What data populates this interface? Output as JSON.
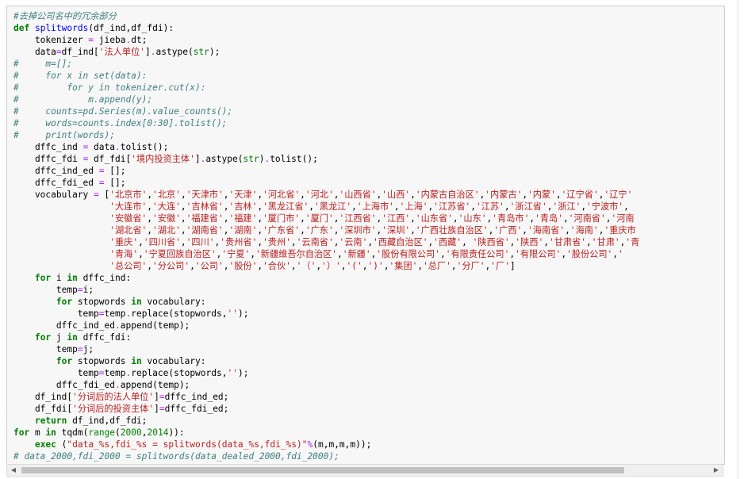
{
  "code_lines": [
    [
      {
        "c": "cm",
        "t": "#去掉公司名中的冗余部分"
      }
    ],
    [
      {
        "c": "kw",
        "t": "def "
      },
      {
        "c": "fn",
        "t": "splitwords"
      },
      {
        "c": "",
        "t": "(df_ind,df_fdi):"
      }
    ],
    [
      {
        "c": "",
        "t": "    tokenizer "
      },
      {
        "c": "op",
        "t": "="
      },
      {
        "c": "",
        "t": " jieba"
      },
      {
        "c": "op",
        "t": "."
      },
      {
        "c": "",
        "t": "dt;"
      }
    ],
    [
      {
        "c": "",
        "t": "    data"
      },
      {
        "c": "op",
        "t": "="
      },
      {
        "c": "",
        "t": "df_ind["
      },
      {
        "c": "st",
        "t": "'法人单位'"
      },
      {
        "c": "",
        "t": "]"
      },
      {
        "c": "op",
        "t": "."
      },
      {
        "c": "",
        "t": "astype("
      },
      {
        "c": "bi",
        "t": "str"
      },
      {
        "c": "",
        "t": ");"
      }
    ],
    [
      {
        "c": "cm",
        "t": "#     m=[];"
      }
    ],
    [
      {
        "c": "cm",
        "t": "#     for x in set(data):"
      }
    ],
    [
      {
        "c": "cm",
        "t": "#         for y in tokenizer.cut(x):"
      }
    ],
    [
      {
        "c": "cm",
        "t": "#             m.append(y);"
      }
    ],
    [
      {
        "c": "cm",
        "t": "#     counts=pd.Series(m).value_counts();"
      }
    ],
    [
      {
        "c": "cm",
        "t": "#     words=counts.index[0:30].tolist();"
      }
    ],
    [
      {
        "c": "cm",
        "t": "#     print(words);"
      }
    ],
    [
      {
        "c": "",
        "t": "    dffc_ind "
      },
      {
        "c": "op",
        "t": "="
      },
      {
        "c": "",
        "t": " data"
      },
      {
        "c": "op",
        "t": "."
      },
      {
        "c": "",
        "t": "tolist();"
      }
    ],
    [
      {
        "c": "",
        "t": "    dffc_fdi "
      },
      {
        "c": "op",
        "t": "="
      },
      {
        "c": "",
        "t": " df_fdi["
      },
      {
        "c": "st",
        "t": "'境内投资主体'"
      },
      {
        "c": "",
        "t": "]"
      },
      {
        "c": "op",
        "t": "."
      },
      {
        "c": "",
        "t": "astype("
      },
      {
        "c": "bi",
        "t": "str"
      },
      {
        "c": "",
        "t": ")"
      },
      {
        "c": "op",
        "t": "."
      },
      {
        "c": "",
        "t": "tolist();"
      }
    ],
    [
      {
        "c": "",
        "t": "    dffc_ind_ed "
      },
      {
        "c": "op",
        "t": "="
      },
      {
        "c": "",
        "t": " [];"
      }
    ],
    [
      {
        "c": "",
        "t": "    dffc_fdi_ed "
      },
      {
        "c": "op",
        "t": "="
      },
      {
        "c": "",
        "t": " [];"
      }
    ],
    [
      {
        "c": "",
        "t": "    vocabulary "
      },
      {
        "c": "op",
        "t": "="
      },
      {
        "c": "",
        "t": " ["
      },
      {
        "c": "st",
        "t": "'北京市'"
      },
      {
        "c": "",
        "t": ","
      },
      {
        "c": "st",
        "t": "'北京'"
      },
      {
        "c": "",
        "t": ","
      },
      {
        "c": "st",
        "t": "'天津市'"
      },
      {
        "c": "",
        "t": ","
      },
      {
        "c": "st",
        "t": "'天津'"
      },
      {
        "c": "",
        "t": ","
      },
      {
        "c": "st",
        "t": "'河北省'"
      },
      {
        "c": "",
        "t": ","
      },
      {
        "c": "st",
        "t": "'河北'"
      },
      {
        "c": "",
        "t": ","
      },
      {
        "c": "st",
        "t": "'山西省'"
      },
      {
        "c": "",
        "t": ","
      },
      {
        "c": "st",
        "t": "'山西'"
      },
      {
        "c": "",
        "t": ","
      },
      {
        "c": "st",
        "t": "'内蒙古自治区'"
      },
      {
        "c": "",
        "t": ","
      },
      {
        "c": "st",
        "t": "'内蒙古'"
      },
      {
        "c": "",
        "t": ","
      },
      {
        "c": "st",
        "t": "'内蒙'"
      },
      {
        "c": "",
        "t": ","
      },
      {
        "c": "st",
        "t": "'辽宁省'"
      },
      {
        "c": "",
        "t": ","
      },
      {
        "c": "st",
        "t": "'辽宁'"
      }
    ],
    [
      {
        "c": "",
        "t": "                  "
      },
      {
        "c": "st",
        "t": "'大连市'"
      },
      {
        "c": "",
        "t": ","
      },
      {
        "c": "st",
        "t": "'大连'"
      },
      {
        "c": "",
        "t": ","
      },
      {
        "c": "st",
        "t": "'吉林省'"
      },
      {
        "c": "",
        "t": ","
      },
      {
        "c": "st",
        "t": "'吉林'"
      },
      {
        "c": "",
        "t": ","
      },
      {
        "c": "st",
        "t": "'黑龙江省'"
      },
      {
        "c": "",
        "t": ","
      },
      {
        "c": "st",
        "t": "'黑龙江'"
      },
      {
        "c": "",
        "t": ","
      },
      {
        "c": "st",
        "t": "'上海市'"
      },
      {
        "c": "",
        "t": ","
      },
      {
        "c": "st",
        "t": "'上海'"
      },
      {
        "c": "",
        "t": ","
      },
      {
        "c": "st",
        "t": "'江苏省'"
      },
      {
        "c": "",
        "t": ","
      },
      {
        "c": "st",
        "t": "'江苏'"
      },
      {
        "c": "",
        "t": ","
      },
      {
        "c": "st",
        "t": "'浙江省'"
      },
      {
        "c": "",
        "t": ","
      },
      {
        "c": "st",
        "t": "'浙江'"
      },
      {
        "c": "",
        "t": ","
      },
      {
        "c": "st",
        "t": "'宁波市'"
      },
      {
        "c": "",
        "t": ","
      }
    ],
    [
      {
        "c": "",
        "t": "                  "
      },
      {
        "c": "st",
        "t": "'安徽省'"
      },
      {
        "c": "",
        "t": ","
      },
      {
        "c": "st",
        "t": "'安徽'"
      },
      {
        "c": "",
        "t": ","
      },
      {
        "c": "st",
        "t": "'福建省'"
      },
      {
        "c": "",
        "t": ","
      },
      {
        "c": "st",
        "t": "'福建'"
      },
      {
        "c": "",
        "t": ","
      },
      {
        "c": "st",
        "t": "'厦门市'"
      },
      {
        "c": "",
        "t": ","
      },
      {
        "c": "st",
        "t": "'厦门'"
      },
      {
        "c": "",
        "t": ","
      },
      {
        "c": "st",
        "t": "'江西省'"
      },
      {
        "c": "",
        "t": ","
      },
      {
        "c": "st",
        "t": "'江西'"
      },
      {
        "c": "",
        "t": ","
      },
      {
        "c": "st",
        "t": "'山东省'"
      },
      {
        "c": "",
        "t": ","
      },
      {
        "c": "st",
        "t": "'山东'"
      },
      {
        "c": "",
        "t": ","
      },
      {
        "c": "st",
        "t": "'青岛市'"
      },
      {
        "c": "",
        "t": ","
      },
      {
        "c": "st",
        "t": "'青岛'"
      },
      {
        "c": "",
        "t": ","
      },
      {
        "c": "st",
        "t": "'河南省'"
      },
      {
        "c": "",
        "t": ","
      },
      {
        "c": "st",
        "t": "'河南"
      }
    ],
    [
      {
        "c": "",
        "t": "                  "
      },
      {
        "c": "st",
        "t": "'湖北省'"
      },
      {
        "c": "",
        "t": ","
      },
      {
        "c": "st",
        "t": "'湖北'"
      },
      {
        "c": "",
        "t": ","
      },
      {
        "c": "st",
        "t": "'湖南省'"
      },
      {
        "c": "",
        "t": ","
      },
      {
        "c": "st",
        "t": "'湖南'"
      },
      {
        "c": "",
        "t": ","
      },
      {
        "c": "st",
        "t": "'广东省'"
      },
      {
        "c": "",
        "t": ","
      },
      {
        "c": "st",
        "t": "'广东'"
      },
      {
        "c": "",
        "t": ","
      },
      {
        "c": "st",
        "t": "'深圳市'"
      },
      {
        "c": "",
        "t": ","
      },
      {
        "c": "st",
        "t": "'深圳'"
      },
      {
        "c": "",
        "t": ","
      },
      {
        "c": "st",
        "t": "'广西壮族自治区'"
      },
      {
        "c": "",
        "t": ","
      },
      {
        "c": "st",
        "t": "'广西'"
      },
      {
        "c": "",
        "t": ","
      },
      {
        "c": "st",
        "t": "'海南省'"
      },
      {
        "c": "",
        "t": ","
      },
      {
        "c": "st",
        "t": "'海南'"
      },
      {
        "c": "",
        "t": ","
      },
      {
        "c": "st",
        "t": "'重庆市"
      }
    ],
    [
      {
        "c": "",
        "t": "                  "
      },
      {
        "c": "st",
        "t": "'重庆'"
      },
      {
        "c": "",
        "t": ","
      },
      {
        "c": "st",
        "t": "'四川省'"
      },
      {
        "c": "",
        "t": ","
      },
      {
        "c": "st",
        "t": "'四川'"
      },
      {
        "c": "",
        "t": ","
      },
      {
        "c": "st",
        "t": "'贵州省'"
      },
      {
        "c": "",
        "t": ","
      },
      {
        "c": "st",
        "t": "'贵州'"
      },
      {
        "c": "",
        "t": ","
      },
      {
        "c": "st",
        "t": "'云南省'"
      },
      {
        "c": "",
        "t": ","
      },
      {
        "c": "st",
        "t": "'云南'"
      },
      {
        "c": "",
        "t": ","
      },
      {
        "c": "st",
        "t": "'西藏自治区'"
      },
      {
        "c": "",
        "t": ","
      },
      {
        "c": "st",
        "t": "'西藏'"
      },
      {
        "c": "",
        "t": ", "
      },
      {
        "c": "st",
        "t": "'陕西省'"
      },
      {
        "c": "",
        "t": ","
      },
      {
        "c": "st",
        "t": "'陕西'"
      },
      {
        "c": "",
        "t": ","
      },
      {
        "c": "st",
        "t": "'甘肃省'"
      },
      {
        "c": "",
        "t": ","
      },
      {
        "c": "st",
        "t": "'甘肃'"
      },
      {
        "c": "",
        "t": ","
      },
      {
        "c": "st",
        "t": "'青"
      }
    ],
    [
      {
        "c": "",
        "t": "                  "
      },
      {
        "c": "st",
        "t": "'青海'"
      },
      {
        "c": "",
        "t": ","
      },
      {
        "c": "st",
        "t": "'宁夏回族自治区'"
      },
      {
        "c": "",
        "t": ","
      },
      {
        "c": "st",
        "t": "'宁夏'"
      },
      {
        "c": "",
        "t": ","
      },
      {
        "c": "st",
        "t": "'新疆维吾尔自治区'"
      },
      {
        "c": "",
        "t": ","
      },
      {
        "c": "st",
        "t": "'新疆'"
      },
      {
        "c": "",
        "t": ","
      },
      {
        "c": "st",
        "t": "'股份有限公司'"
      },
      {
        "c": "",
        "t": ","
      },
      {
        "c": "st",
        "t": "'有限责任公司'"
      },
      {
        "c": "",
        "t": ","
      },
      {
        "c": "st",
        "t": "'有限公司'"
      },
      {
        "c": "",
        "t": ","
      },
      {
        "c": "st",
        "t": "'股份公司'"
      },
      {
        "c": "",
        "t": ","
      },
      {
        "c": "st",
        "t": "'"
      }
    ],
    [
      {
        "c": "",
        "t": "                  "
      },
      {
        "c": "st",
        "t": "'总公司'"
      },
      {
        "c": "",
        "t": ","
      },
      {
        "c": "st",
        "t": "'分公司'"
      },
      {
        "c": "",
        "t": ","
      },
      {
        "c": "st",
        "t": "'公司'"
      },
      {
        "c": "",
        "t": ","
      },
      {
        "c": "st",
        "t": "'股份'"
      },
      {
        "c": "",
        "t": ","
      },
      {
        "c": "st",
        "t": "'合伙'"
      },
      {
        "c": "",
        "t": ","
      },
      {
        "c": "st",
        "t": "'（'"
      },
      {
        "c": "",
        "t": ","
      },
      {
        "c": "st",
        "t": "'）'"
      },
      {
        "c": "",
        "t": ","
      },
      {
        "c": "st",
        "t": "'('"
      },
      {
        "c": "",
        "t": ","
      },
      {
        "c": "st",
        "t": "')'"
      },
      {
        "c": "",
        "t": ","
      },
      {
        "c": "st",
        "t": "'集团'"
      },
      {
        "c": "",
        "t": ","
      },
      {
        "c": "st",
        "t": "'总厂'"
      },
      {
        "c": "",
        "t": ","
      },
      {
        "c": "st",
        "t": "'分厂'"
      },
      {
        "c": "",
        "t": ","
      },
      {
        "c": "st",
        "t": "'厂'"
      },
      {
        "c": "",
        "t": "]"
      }
    ],
    [
      {
        "c": "",
        "t": "    "
      },
      {
        "c": "kw",
        "t": "for"
      },
      {
        "c": "",
        "t": " i "
      },
      {
        "c": "kw",
        "t": "in"
      },
      {
        "c": "",
        "t": " dffc_ind:"
      }
    ],
    [
      {
        "c": "",
        "t": "        temp"
      },
      {
        "c": "op",
        "t": "="
      },
      {
        "c": "",
        "t": "i;"
      }
    ],
    [
      {
        "c": "",
        "t": "        "
      },
      {
        "c": "kw",
        "t": "for"
      },
      {
        "c": "",
        "t": " stopwords "
      },
      {
        "c": "kw",
        "t": "in"
      },
      {
        "c": "",
        "t": " vocabulary:"
      }
    ],
    [
      {
        "c": "",
        "t": "            temp"
      },
      {
        "c": "op",
        "t": "="
      },
      {
        "c": "",
        "t": "temp"
      },
      {
        "c": "op",
        "t": "."
      },
      {
        "c": "",
        "t": "replace(stopwords,"
      },
      {
        "c": "st",
        "t": "''"
      },
      {
        "c": "",
        "t": ");"
      }
    ],
    [
      {
        "c": "",
        "t": "        dffc_ind_ed"
      },
      {
        "c": "op",
        "t": "."
      },
      {
        "c": "",
        "t": "append(temp);"
      }
    ],
    [
      {
        "c": "",
        "t": "    "
      },
      {
        "c": "kw",
        "t": "for"
      },
      {
        "c": "",
        "t": " j "
      },
      {
        "c": "kw",
        "t": "in"
      },
      {
        "c": "",
        "t": " dffc_fdi:"
      }
    ],
    [
      {
        "c": "",
        "t": "        temp"
      },
      {
        "c": "op",
        "t": "="
      },
      {
        "c": "",
        "t": "j;"
      }
    ],
    [
      {
        "c": "",
        "t": "        "
      },
      {
        "c": "kw",
        "t": "for"
      },
      {
        "c": "",
        "t": " stopwords "
      },
      {
        "c": "kw",
        "t": "in"
      },
      {
        "c": "",
        "t": " vocabulary:"
      }
    ],
    [
      {
        "c": "",
        "t": "            temp"
      },
      {
        "c": "op",
        "t": "="
      },
      {
        "c": "",
        "t": "temp"
      },
      {
        "c": "op",
        "t": "."
      },
      {
        "c": "",
        "t": "replace(stopwords,"
      },
      {
        "c": "st",
        "t": "''"
      },
      {
        "c": "",
        "t": ");"
      }
    ],
    [
      {
        "c": "",
        "t": "        dffc_fdi_ed"
      },
      {
        "c": "op",
        "t": "."
      },
      {
        "c": "",
        "t": "append(temp);"
      }
    ],
    [
      {
        "c": "",
        "t": "    df_ind["
      },
      {
        "c": "st",
        "t": "'分词后的法人单位'"
      },
      {
        "c": "",
        "t": "]"
      },
      {
        "c": "op",
        "t": "="
      },
      {
        "c": "",
        "t": "dffc_ind_ed;"
      }
    ],
    [
      {
        "c": "",
        "t": "    df_fdi["
      },
      {
        "c": "st",
        "t": "'分词后的投资主体'"
      },
      {
        "c": "",
        "t": "]"
      },
      {
        "c": "op",
        "t": "="
      },
      {
        "c": "",
        "t": "dffc_fdi_ed;"
      }
    ],
    [
      {
        "c": "",
        "t": "    "
      },
      {
        "c": "kw",
        "t": "return"
      },
      {
        "c": "",
        "t": " df_ind,df_fdi;"
      }
    ],
    [
      {
        "c": "kw",
        "t": "for"
      },
      {
        "c": "",
        "t": " m "
      },
      {
        "c": "kw",
        "t": "in"
      },
      {
        "c": "",
        "t": " tqdm("
      },
      {
        "c": "bi",
        "t": "range"
      },
      {
        "c": "",
        "t": "("
      },
      {
        "c": "num",
        "t": "2000"
      },
      {
        "c": "",
        "t": ","
      },
      {
        "c": "num",
        "t": "2014"
      },
      {
        "c": "",
        "t": ")):"
      }
    ],
    [
      {
        "c": "",
        "t": "    "
      },
      {
        "c": "kw",
        "t": "exec"
      },
      {
        "c": "",
        "t": " ("
      },
      {
        "c": "st",
        "t": "\"data_%s,fdi_%s = splitwords(data_%s,fdi_%s)\""
      },
      {
        "c": "op",
        "t": "%"
      },
      {
        "c": "",
        "t": "(m,m,m,m));"
      }
    ],
    [
      {
        "c": "cm",
        "t": "# data_2000,fdi_2000 = splitwords(data_dealed_2000,fdi_2000);"
      }
    ]
  ],
  "scrollbar": {
    "left_icon": "◀",
    "right_icon": "▶",
    "position": 0
  },
  "colors": {
    "keyword": "#008000",
    "string": "#ba2121",
    "comment": "#408080",
    "function": "#0000ff",
    "operator": "#aa22ff",
    "cell_background": "#f7f7f7"
  }
}
